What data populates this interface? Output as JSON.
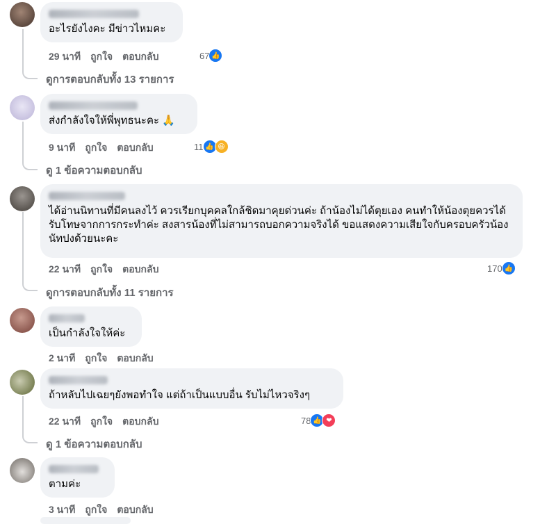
{
  "colors": {
    "like": "#1877f2",
    "haha": "#f7b125",
    "love": "#f33e58",
    "bubble": "#f0f2f5",
    "muted": "#65676b"
  },
  "action_labels": {
    "like": "ถูกใจ",
    "reply": "ตอบกลับ"
  },
  "comments": [
    {
      "text": "อะไรยังไงคะ มีข่าวไหมคะ",
      "time": "29 นาที",
      "reactions_count": "67",
      "reaction_icons": [
        "like-icon"
      ],
      "replies_label": "ดูการตอบกลับทั้ง 13 รายการ"
    },
    {
      "text": "ส่งกำลังใจให้พี่พุทธนะคะ 🙏",
      "time": "9 นาที",
      "reactions_count": "11",
      "reaction_icons": [
        "like-icon",
        "haha-icon"
      ],
      "replies_label": "ดู 1 ข้อความตอบกลับ"
    },
    {
      "text": "ได้อ่านนิทานที่มีคนลงไว้ ควรเรียกบุคคลใกล้ชิดมาคุยด่วนค่ะ ถ้าน้องไม่ได้ตุยเอง คนทำให้น้องตุยควรได้รับโทษจากการกระทำค่ะ สงสารน้องที่ไม่สามารถบอกความจริงได้ ขอแสดงความเสียใจกับครอบครัวน้องนัทปงด้วยนะคะ",
      "time": "22 นาที",
      "reactions_count": "170",
      "reaction_icons": [
        "like-icon"
      ],
      "replies_label": "ดูการตอบกลับทั้ง 11 รายการ"
    },
    {
      "text": "เป็นกำลังใจให้ค่ะ",
      "time": "2 นาที"
    },
    {
      "text": "ถ้าหลับไปเฉยๆยังพอทำใจ แต่ถ้าเป็นแบบอื่น รับไม่ไหวจริงๆ",
      "time": "22 นาที",
      "reactions_count": "78",
      "reaction_icons": [
        "like-icon",
        "love-icon"
      ],
      "replies_label": "ดู 1 ข้อความตอบกลับ"
    },
    {
      "text": "ตามค่ะ",
      "time": "3 นาที"
    }
  ]
}
